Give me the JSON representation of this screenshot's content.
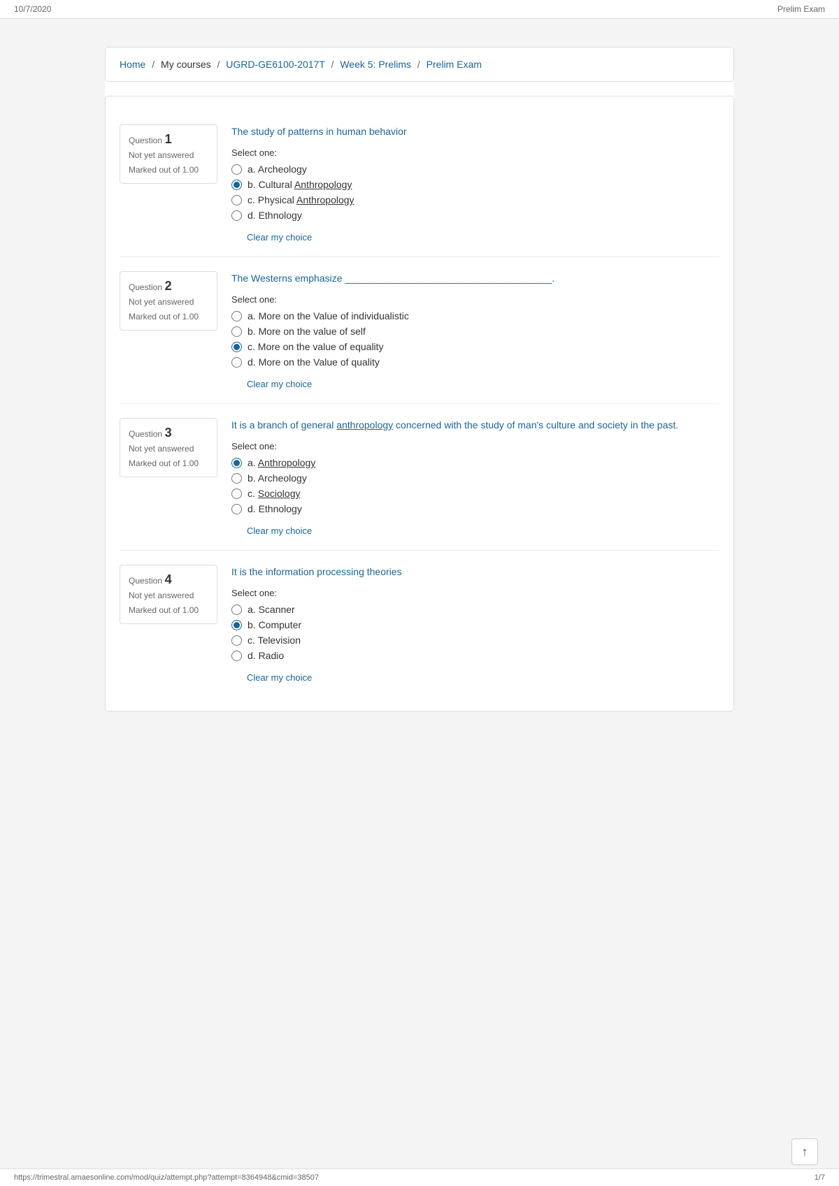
{
  "topbar": {
    "date": "10/7/2020",
    "title": "Prelim Exam"
  },
  "breadcrumb": {
    "home": "Home",
    "separator1": "/",
    "mycourses": "My courses",
    "separator2": "/",
    "course": "UGRD-GE6100-2017T",
    "separator3": "/",
    "week": "Week 5: Prelims",
    "separator4": "/",
    "exam": "Prelim Exam"
  },
  "questions": [
    {
      "number": "1",
      "label": "Question",
      "status": "Not yet answered",
      "mark": "Marked out of 1.00",
      "text": "The study of patterns in human behavior",
      "select_one": "Select one:",
      "options": [
        {
          "id": "q1a",
          "label": "a. Archeology",
          "checked": false
        },
        {
          "id": "q1b",
          "label": "b. Cultural Anthropology",
          "checked": true,
          "underline": "Anthropology"
        },
        {
          "id": "q1c",
          "label": "c. Physical Anthropology",
          "checked": false,
          "underline": "Anthropology"
        },
        {
          "id": "q1d",
          "label": "d. Ethnology",
          "checked": false
        }
      ],
      "clear_choice": "Clear my choice"
    },
    {
      "number": "2",
      "label": "Question",
      "status": "Not yet answered",
      "mark": "Marked out of 1.00",
      "text": "The Westerns emphasize ______________________________________.",
      "select_one": "Select one:",
      "options": [
        {
          "id": "q2a",
          "label": "a. More on the Value of individualistic",
          "checked": false
        },
        {
          "id": "q2b",
          "label": "b. More on the value of self",
          "checked": false
        },
        {
          "id": "q2c",
          "label": "c. More on the value of equality",
          "checked": true
        },
        {
          "id": "q2d",
          "label": "d. More on the Value of quality",
          "checked": false
        }
      ],
      "clear_choice": "Clear my choice"
    },
    {
      "number": "3",
      "label": "Question",
      "status": "Not yet answered",
      "mark": "Marked out of 1.00",
      "text": "It is a branch of general anthropology concerned with the study of man's culture and society in the past.",
      "text_underline": "anthropology",
      "select_one": "Select one:",
      "options": [
        {
          "id": "q3a",
          "label": "a. Anthropology",
          "checked": true,
          "underline": "Anthropology"
        },
        {
          "id": "q3b",
          "label": "b. Archeology",
          "checked": false
        },
        {
          "id": "q3c",
          "label": "c. Sociology",
          "checked": false,
          "underline": "Sociology"
        },
        {
          "id": "q3d",
          "label": "d. Ethnology",
          "checked": false
        }
      ],
      "clear_choice": "Clear my choice"
    },
    {
      "number": "4",
      "label": "Question",
      "status": "Not yet answered",
      "mark": "Marked out of 1.00",
      "text": "It is the information processing theories",
      "select_one": "Select one:",
      "options": [
        {
          "id": "q4a",
          "label": "a. Scanner",
          "checked": false
        },
        {
          "id": "q4b",
          "label": "b. Computer",
          "checked": true
        },
        {
          "id": "q4c",
          "label": "c. Television",
          "checked": false
        },
        {
          "id": "q4d",
          "label": "d. Radio",
          "checked": false
        }
      ],
      "clear_choice": "Clear my choice"
    }
  ],
  "bottombar": {
    "url": "https://trimestral.amaesonline.com/mod/quiz/attempt.php?attempt=8364948&cmid=38507",
    "page": "1/7"
  },
  "scroll_up_icon": "↑"
}
